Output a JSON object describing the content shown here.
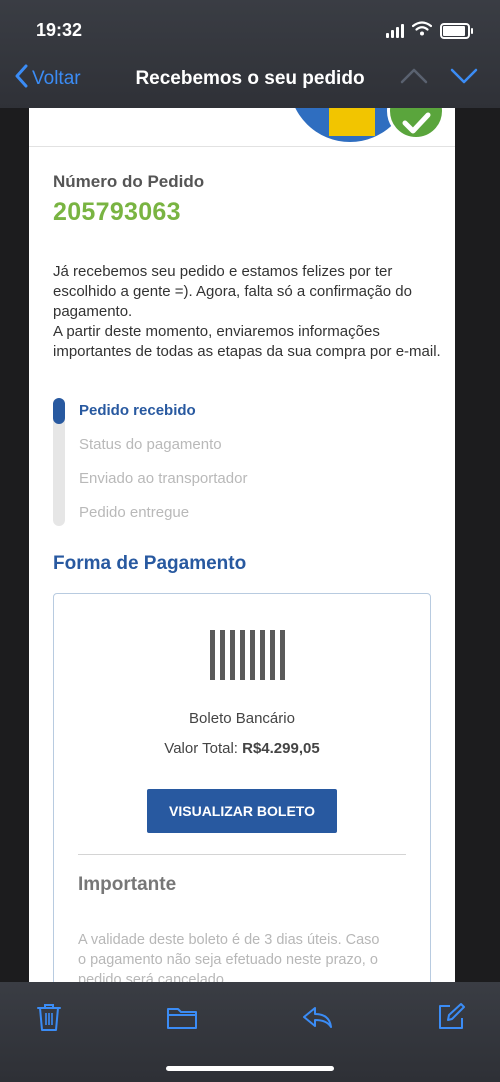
{
  "status_bar": {
    "time": "19:32"
  },
  "nav": {
    "back_label": "Voltar",
    "title": "Recebemos o seu pedido"
  },
  "order": {
    "label": "Número do Pedido",
    "number": "205793063",
    "message_lines": [
      "Já recebemos seu pedido e estamos felizes por ter escolhido a gente =). Agora, falta só a confirmação do pagamento.",
      "A partir deste momento, enviaremos informações importantes de todas as etapas da sua compra por e-mail."
    ]
  },
  "steps": [
    {
      "label": "Pedido recebido",
      "active": true
    },
    {
      "label": "Status do pagamento",
      "active": false
    },
    {
      "label": "Enviado ao transportador",
      "active": false
    },
    {
      "label": "Pedido entregue",
      "active": false
    }
  ],
  "payment": {
    "heading": "Forma de Pagamento",
    "method": "Boleto Bancário",
    "total_label": "Valor Total:",
    "total_value": "R$4.299,05",
    "button_label": "VISUALIZAR BOLETO",
    "barcode_icon": "barcode-icon"
  },
  "important": {
    "title": "Importante",
    "text": "A validade deste boleto é de 3 dias úteis. Caso o pagamento não seja efetuado neste prazo, o pedido será cancelado."
  },
  "toolbar": {
    "icons": [
      "trash-icon",
      "folder-icon",
      "reply-icon",
      "compose-icon"
    ]
  },
  "colors": {
    "accent_blue": "#2859a0",
    "ios_blue": "#3b8cf5",
    "order_green": "#79b442",
    "check_green": "#5aa53c"
  }
}
